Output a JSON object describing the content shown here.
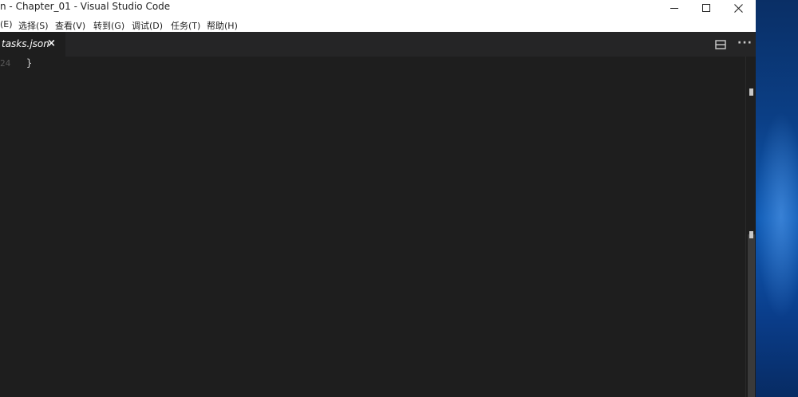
{
  "window": {
    "title": "n - Chapter_01 - Visual Studio Code"
  },
  "menubar": {
    "items": [
      {
        "label": "(E)"
      },
      {
        "label": "选择(S)"
      },
      {
        "label": "查看(V)"
      },
      {
        "label": "转到(G)"
      },
      {
        "label": "调试(D)"
      },
      {
        "label": "任务(T)"
      },
      {
        "label": "帮助(H)"
      }
    ]
  },
  "tabs": [
    {
      "label": "tasks.json",
      "close": "×",
      "active": true
    }
  ],
  "editor": {
    "line_number": "24",
    "code": "}"
  },
  "icons": {
    "minimize": "window-minimize-icon",
    "maximize": "window-maximize-icon",
    "close": "window-close-icon",
    "split_editor": "split-editor-icon",
    "more_actions": "ellipsis-icon"
  },
  "toolbar": {
    "more_actions_label": "···"
  },
  "colors": {
    "editor_bg": "#1e1e1e",
    "tab_bar_bg": "#252526",
    "titlebar_bg": "#ffffff",
    "desktop_bg": "#0b3f86"
  }
}
